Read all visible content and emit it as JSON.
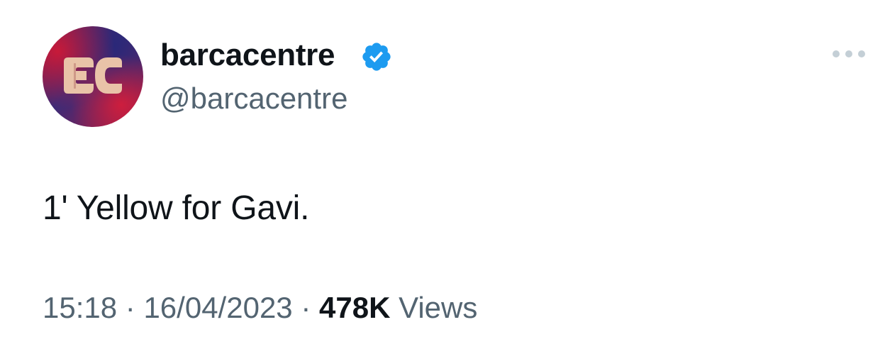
{
  "author": {
    "display_name": "barcacentre",
    "handle": "@barcacentre",
    "avatar_icon": "barcacentre-logo-icon",
    "avatar_text": "EC",
    "verified": true,
    "verified_icon": "verified-badge-icon",
    "verified_color": "#1d9bf0"
  },
  "menu": {
    "icon": "more-options-icon"
  },
  "tweet": {
    "text": "1' Yellow for Gavi."
  },
  "meta": {
    "time": "15:18",
    "separator_1": "·",
    "date": "16/04/2023",
    "separator_2": "·",
    "views_count": "478K",
    "views_label": "Views"
  },
  "colors": {
    "text_primary": "#0f1419",
    "text_secondary": "#536471",
    "avatar_logo": "#e9c3a8",
    "menu_dots": "#c4cfd6"
  }
}
